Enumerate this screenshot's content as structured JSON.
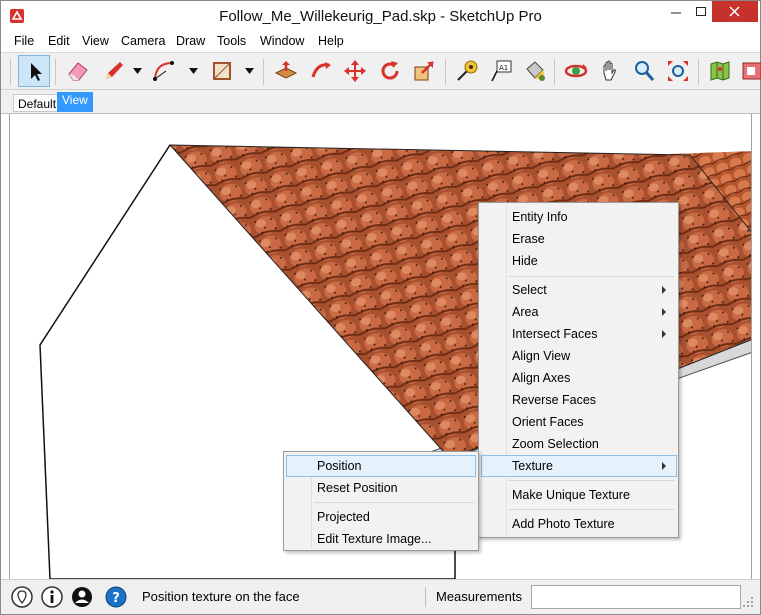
{
  "window": {
    "title": "Follow_Me_Willekeurig_Pad.skp - SketchUp Pro"
  },
  "menubar": {
    "items": [
      "File",
      "Edit",
      "View",
      "Camera",
      "Draw",
      "Tools",
      "Window",
      "Help"
    ]
  },
  "toolbar": {
    "tools": [
      "select-icon",
      "eraser-icon",
      "pencil-icon",
      "arc-icon",
      "rectangle-icon",
      "push-pull-icon",
      "follow-me-icon",
      "move-icon",
      "rotate-icon",
      "scale-icon",
      "tape-measure-icon",
      "text-icon",
      "paint-bucket-icon",
      "orbit-icon",
      "pan-icon",
      "zoom-icon",
      "zoom-extents-icon",
      "map-icon",
      "extension-icon"
    ]
  },
  "scene_tabs": {
    "tabs": [
      "Default",
      "View"
    ],
    "selected": "View"
  },
  "context_menu": {
    "items": [
      "Entity Info",
      "Erase",
      "Hide",
      "Select",
      "Area",
      "Intersect Faces",
      "Align View",
      "Align Axes",
      "Reverse Faces",
      "Orient Faces",
      "Zoom Selection",
      "Texture",
      "Make Unique Texture",
      "Add Photo Texture"
    ],
    "highlighted": "Texture"
  },
  "texture_submenu": {
    "items": [
      "Position",
      "Reset Position",
      "Projected",
      "Edit Texture Image..."
    ],
    "highlighted": "Position"
  },
  "statusbar": {
    "hint": "Position texture on the face",
    "measurements_label": "Measurements",
    "measurements_value": ""
  },
  "colors": {
    "accent": "#3399ff",
    "close_button": "#c7312c",
    "roof_tile": "#b55a36",
    "menu_highlight": "#e5f1fb"
  }
}
